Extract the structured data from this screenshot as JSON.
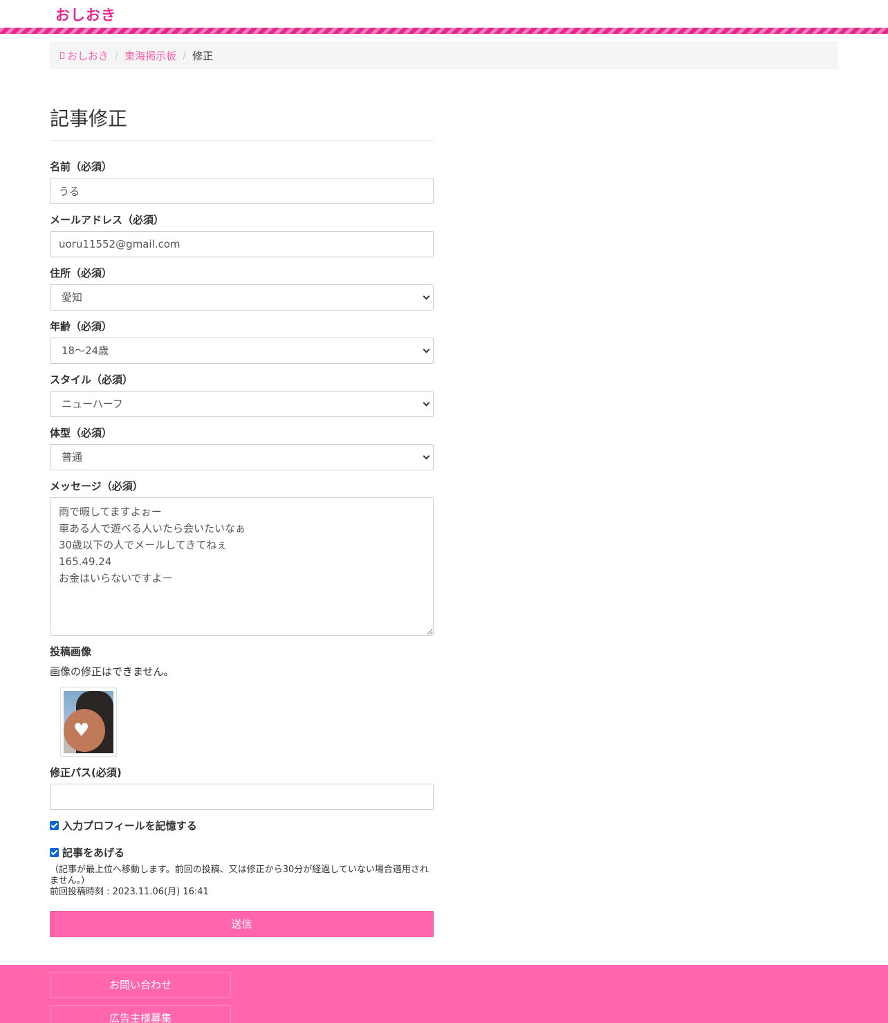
{
  "site": {
    "logo": "おしおき"
  },
  "breadcrumb": {
    "home": "おしおき",
    "board": "東海掲示板",
    "current": "修正"
  },
  "form": {
    "title": "記事修正",
    "name_label": "名前（必須）",
    "name_value": "うる",
    "email_label": "メールアドレス（必須）",
    "email_value": "uoru11552@gmail.com",
    "address_label": "住所（必須）",
    "address_value": "愛知",
    "age_label": "年齢（必須）",
    "age_value": "18〜24歳",
    "style_label": "スタイル（必須）",
    "style_value": "ニューハーフ",
    "body_label": "体型（必須）",
    "body_value": "普通",
    "message_label": "メッセージ（必須）",
    "message_value": "雨で暇してますよぉー\n車ある人で遊べる人いたら会いたいなぁ\n30歳以下の人でメールしてきてねぇ\n165.49.24\nお金はいらないですよー",
    "image_label": "投稿画像",
    "image_note": "画像の修正はできません。",
    "password_label": "修正パス(必須)",
    "password_value": "",
    "remember_label": "入力プロフィールを記憶する",
    "remember_checked": true,
    "bump_label": "記事をあげる",
    "bump_checked": true,
    "bump_note": "（記事が最上位へ移動します。前回の投稿、又は修正から30分が経過していない場合適用されません。）",
    "last_post": "前回投稿時刻 : 2023.11.06(月) 16:41",
    "submit_label": "送信"
  },
  "footer": {
    "contact": "お問い合わせ",
    "advertisers": "広告主様募集"
  },
  "colors": {
    "brand": "#e62691",
    "accent": "#ff66ad",
    "checkbox": "#0a66d4"
  }
}
